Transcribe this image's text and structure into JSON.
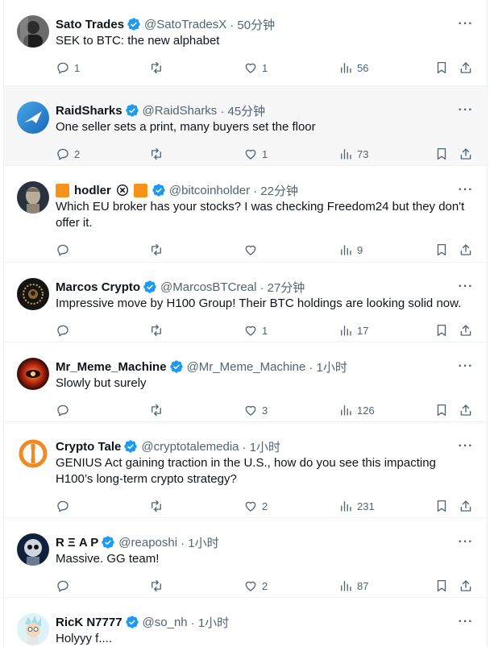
{
  "colors": {
    "accent": "#1d9bf0",
    "muted": "#536471",
    "text": "#0f1419",
    "highlight_bg": "#f7f7f7",
    "square": "#f7931a"
  },
  "icons": {
    "reply": "reply-icon",
    "retweet": "retweet-icon",
    "like": "heart-icon",
    "views": "analytics-icon",
    "bookmark": "bookmark-icon",
    "share": "share-icon",
    "more": "more-icon",
    "verified": "verified-badge-icon"
  },
  "tweets": [
    {
      "name": "Sato Trades",
      "handle": "@SatoTradesX",
      "time": "· 50分钟",
      "text": "SEK to BTC: the new alphabet",
      "replies": "1",
      "retweets": "",
      "likes": "1",
      "views": "56"
    },
    {
      "name": "RaidSharks",
      "handle": "@RaidSharks",
      "time": "· 45分钟",
      "text": "One seller sets a print, many buyers set the floor",
      "replies": "2",
      "retweets": "",
      "likes": "1",
      "views": "73"
    },
    {
      "name": "hodler",
      "handle": "@bitcoinholder",
      "time": "· 22分钟",
      "text": "Which EU broker has your stocks? I was checking Freedom24 but they don't offer it.",
      "replies": "",
      "retweets": "",
      "likes": "",
      "views": "9"
    },
    {
      "name": "Marcos Crypto",
      "handle": "@MarcosBTCreal",
      "time": "· 27分钟",
      "text": "Impressive move by H100 Group! Their BTC holdings are looking solid now.",
      "replies": "",
      "retweets": "",
      "likes": "1",
      "views": "17"
    },
    {
      "name": "Mr_Meme_Machine",
      "handle": "@Mr_Meme_Machine",
      "time": "· 1小时",
      "text": "Slowly but surely",
      "replies": "",
      "retweets": "",
      "likes": "3",
      "views": "126"
    },
    {
      "name": "Crypto Tale",
      "handle": "@cryptotalemedia",
      "time": "· 1小时",
      "text": "GENIUS Act gaining traction in the U.S., how do you see this impacting H100’s long-term crypto strategy?",
      "replies": "",
      "retweets": "",
      "likes": "2",
      "views": "231"
    },
    {
      "name": "R Ξ A P",
      "handle": "@reaposhi",
      "time": "· 1小时",
      "text": "Massive. GG team!",
      "replies": "",
      "retweets": "",
      "likes": "2",
      "views": "87"
    },
    {
      "name": "RicK N7777",
      "handle": "@so_nh",
      "time": "· 1小时",
      "text": "Holyyy f....",
      "replies": "",
      "retweets": "",
      "likes": "",
      "views": ""
    }
  ]
}
